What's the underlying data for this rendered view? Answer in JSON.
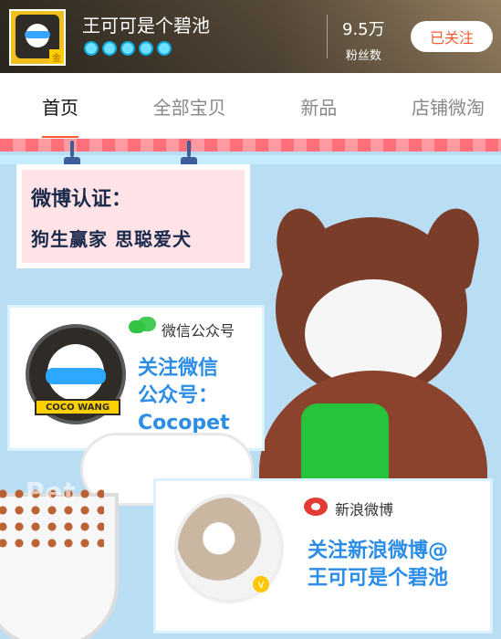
{
  "header": {
    "shop_name": "王可可是个碧池",
    "fans_count": "9.5万",
    "fans_label": "粉丝数",
    "follow_label": "已关注",
    "avatar_badge": "金",
    "avatar_text": "COCO WANG",
    "vip_icons": [
      "blue-crown-icon",
      "blue-crown-icon",
      "blue-crown-icon",
      "blue-crown-icon",
      "blue-crown-icon"
    ]
  },
  "tabs": [
    {
      "label": "首页",
      "active": true
    },
    {
      "label": "全部宝贝",
      "active": false
    },
    {
      "label": "新品",
      "active": false
    },
    {
      "label": "店铺微淘",
      "active": false
    }
  ],
  "banner": {
    "tag_title": "微博认证：",
    "tag_body": "狗生赢家 思聪爱犬",
    "wechat": {
      "label": "微信公众号",
      "lines": [
        "关注微信",
        "公众号：",
        "Cocopet"
      ]
    },
    "weibo": {
      "label": "新浪微博",
      "lines": [
        "关注新浪微博@",
        "王可可是个碧池"
      ]
    },
    "logo_text": "COCO WANG",
    "pet_word": "Pet",
    "v_badge": "v"
  },
  "colors": {
    "accent": "#ff5a34",
    "banner_bg": "#b9def4",
    "text_blue": "#2b8de6",
    "wechat_green": "#31c442",
    "weibo_red": "#e33b33"
  }
}
